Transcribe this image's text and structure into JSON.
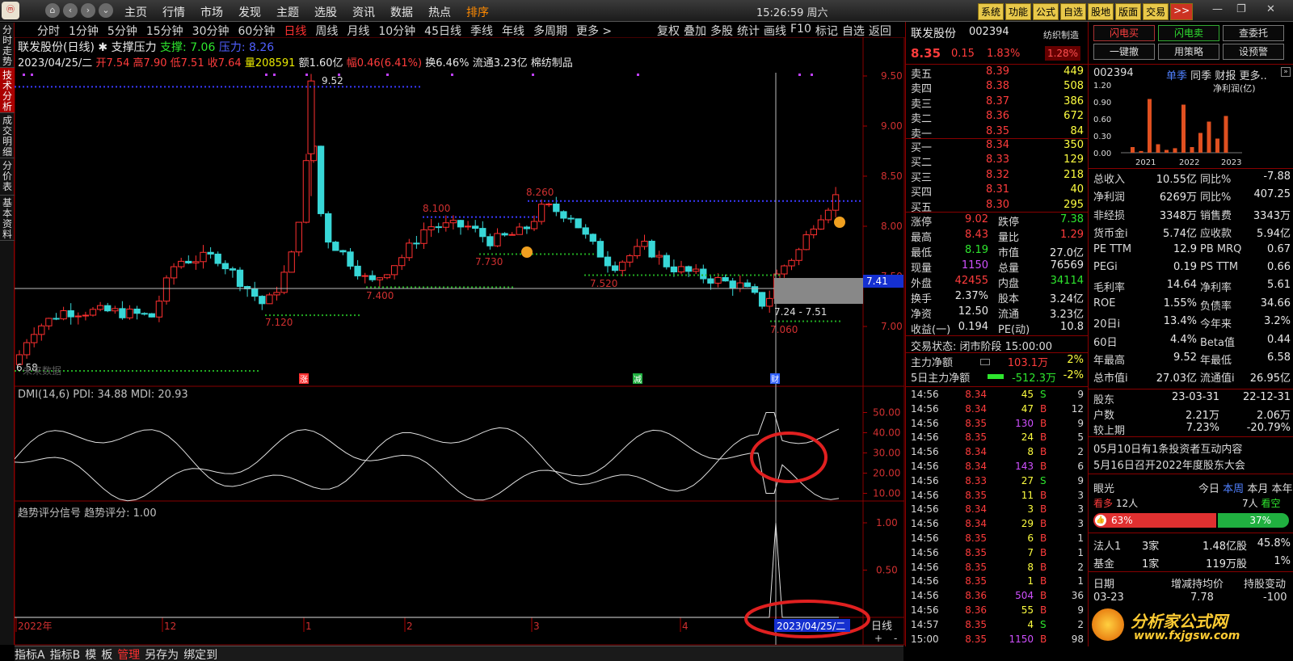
{
  "topbar": {
    "logo": "ⓜ",
    "menu": [
      "主页",
      "行情",
      "市场",
      "发现",
      "主题",
      "选股",
      "资讯",
      "数据",
      "热点",
      "排序"
    ],
    "clock": "15:26:59 周六",
    "buttons": [
      "系统",
      "功能",
      "公式",
      "自选",
      "股地",
      "版面",
      "交易",
      ">>"
    ]
  },
  "vtabs": [
    "分时走势",
    "技术分析",
    "成交明细",
    "分价表",
    "基本资料"
  ],
  "chart_toolbar": {
    "periods": [
      "分时",
      "1分钟",
      "5分钟",
      "15分钟",
      "30分钟",
      "60分钟",
      "日线",
      "周线",
      "月线",
      "10分钟",
      "45日线",
      "季线",
      "年线",
      "多周期",
      "更多 >"
    ],
    "active_period": "日线",
    "right_tools": [
      "复权",
      "叠加",
      "多股",
      "统计",
      "画线",
      "F10",
      "标记",
      "自选",
      "返回"
    ]
  },
  "kline": {
    "title": "联发股份(日线)",
    "indicator": "支撑压力",
    "support_label": "支撑: 7.06",
    "pressure_label": "压力: 8.26",
    "info_date": "2023/04/25/二",
    "info_open": "开7.54",
    "info_high": "高7.90",
    "info_low": "低7.51",
    "info_close": "收7.64",
    "info_vol": "量208591",
    "info_amount": "额1.60亿",
    "info_range": "幅0.46(6.41%)",
    "info_turnover": "换6.46%",
    "info_float": "流通3.23亿",
    "info_industry": "棉纺制品",
    "price_annotations": [
      "9.52",
      "8.100",
      "8.260",
      "7.730",
      "7.520",
      "7.400",
      "7.120",
      "7.24 - 7.51",
      "7.060",
      "6.58"
    ],
    "future_data_label": "未来数据",
    "markers": [
      "涨",
      "减",
      "财"
    ],
    "cursor_price": "7.41"
  },
  "dmi": {
    "label": "DMI(14,6) PDI: 34.88 MDI: 20.93",
    "ticks": [
      "50.00",
      "40.00",
      "30.00",
      "20.00",
      "10.00"
    ]
  },
  "trend": {
    "label": "趋势评分信号  趋势评分: 1.00",
    "ticks": [
      "1.00",
      "0.50"
    ],
    "date_label": "2023/04/25/二",
    "period_label": "日线"
  },
  "x_axis": [
    "2022年",
    "12",
    "1",
    "2",
    "3",
    "4"
  ],
  "statusbar": [
    "指标A",
    "指标B",
    "模",
    "板",
    "管理",
    "另存为",
    "绑定到"
  ],
  "quote": {
    "name": "联发股份",
    "code": "002394",
    "industry": "纺织制造",
    "price": "8.35",
    "change": "0.15",
    "change_pct": "1.83%",
    "industry_pct": "1.28%",
    "asks": [
      {
        "label": "卖五",
        "price": "8.39",
        "vol": "449"
      },
      {
        "label": "卖四",
        "price": "8.38",
        "vol": "508"
      },
      {
        "label": "卖三",
        "price": "8.37",
        "vol": "386"
      },
      {
        "label": "卖二",
        "price": "8.36",
        "vol": "672"
      },
      {
        "label": "卖一",
        "price": "8.35",
        "vol": "84"
      }
    ],
    "bids": [
      {
        "label": "买一",
        "price": "8.34",
        "vol": "350"
      },
      {
        "label": "买二",
        "price": "8.33",
        "vol": "129"
      },
      {
        "label": "买三",
        "price": "8.32",
        "vol": "218"
      },
      {
        "label": "买四",
        "price": "8.31",
        "vol": "40"
      },
      {
        "label": "买五",
        "price": "8.30",
        "vol": "295"
      }
    ],
    "stats": [
      {
        "l1": "涨停",
        "v1": "9.02",
        "c1": "red",
        "l2": "跌停",
        "v2": "7.38",
        "c2": "green"
      },
      {
        "l1": "最高",
        "v1": "8.43",
        "c1": "red",
        "l2": "量比",
        "v2": "1.29",
        "c2": "red"
      },
      {
        "l1": "最低",
        "v1": "8.19",
        "c1": "green",
        "l2": "市值",
        "v2": "27.0亿",
        "c2": "white"
      },
      {
        "l1": "现量",
        "v1": "1150",
        "c1": "purple",
        "l2": "总量",
        "v2": "76569",
        "c2": "white"
      },
      {
        "l1": "外盘",
        "v1": "42455",
        "c1": "red",
        "l2": "内盘",
        "v2": "34114",
        "c2": "green"
      },
      {
        "l1": "换手",
        "v1": "2.37%",
        "c1": "white",
        "l2": "股本",
        "v2": "3.24亿",
        "c2": "white"
      },
      {
        "l1": "净资",
        "v1": "12.50",
        "c1": "white",
        "l2": "流通",
        "v2": "3.23亿",
        "c2": "white"
      },
      {
        "l1": "收益(一)",
        "v1": "0.194",
        "c1": "white",
        "l2": "PE(动)",
        "v2": "10.8",
        "c2": "white"
      }
    ],
    "trade_status": "交易状态: 闭市阶段 15:00:00",
    "main_net": {
      "label": "主力净额",
      "value": "103.1万",
      "pct": "2%"
    },
    "main_net5": {
      "label": "5日主力净额",
      "value": "-512.3万",
      "pct": "-2%"
    },
    "ticks": [
      {
        "t": "14:56",
        "p": "8.34",
        "v": "45",
        "s": "S",
        "n": "9"
      },
      {
        "t": "14:56",
        "p": "8.34",
        "v": "47",
        "s": "B",
        "n": "12"
      },
      {
        "t": "14:56",
        "p": "8.35",
        "v": "130",
        "s": "B",
        "n": "9"
      },
      {
        "t": "14:56",
        "p": "8.35",
        "v": "24",
        "s": "B",
        "n": "5"
      },
      {
        "t": "14:56",
        "p": "8.34",
        "v": "8",
        "s": "B",
        "n": "2"
      },
      {
        "t": "14:56",
        "p": "8.34",
        "v": "143",
        "s": "B",
        "n": "6"
      },
      {
        "t": "14:56",
        "p": "8.33",
        "v": "27",
        "s": "S",
        "n": "9"
      },
      {
        "t": "14:56",
        "p": "8.35",
        "v": "11",
        "s": "B",
        "n": "3"
      },
      {
        "t": "14:56",
        "p": "8.34",
        "v": "3",
        "s": "B",
        "n": "3"
      },
      {
        "t": "14:56",
        "p": "8.34",
        "v": "29",
        "s": "B",
        "n": "3"
      },
      {
        "t": "14:56",
        "p": "8.35",
        "v": "6",
        "s": "B",
        "n": "1"
      },
      {
        "t": "14:56",
        "p": "8.35",
        "v": "7",
        "s": "B",
        "n": "1"
      },
      {
        "t": "14:56",
        "p": "8.35",
        "v": "8",
        "s": "B",
        "n": "2"
      },
      {
        "t": "14:56",
        "p": "8.35",
        "v": "1",
        "s": "B",
        "n": "1"
      },
      {
        "t": "14:56",
        "p": "8.36",
        "v": "504",
        "s": "B",
        "n": "36"
      },
      {
        "t": "14:56",
        "p": "8.36",
        "v": "55",
        "s": "B",
        "n": "9"
      },
      {
        "t": "14:57",
        "p": "8.35",
        "v": "4",
        "s": "S",
        "n": "2"
      },
      {
        "t": "15:00",
        "p": "8.35",
        "v": "1150",
        "s": "B",
        "n": "98"
      }
    ]
  },
  "fin": {
    "buttons": [
      "闪电买",
      "闪电卖",
      "查委托",
      "一键撤",
      "用策略",
      "设预警"
    ],
    "code": "002394",
    "tabs": [
      "单季",
      "同季",
      "财报",
      "更多.."
    ],
    "chart_label": "净利润(亿)",
    "chart_years": [
      "2021",
      "2022",
      "2023"
    ],
    "chart_ticks": [
      "1.20",
      "0.90",
      "0.60",
      "0.30",
      "0.00"
    ],
    "rows": [
      {
        "l1": "总收入",
        "v1": "10.55亿",
        "l2": "同比%",
        "v2": "-7.88"
      },
      {
        "l1": "净利润",
        "v1": "6269万",
        "l2": "同比%",
        "v2": "407.25"
      },
      {
        "l1": "非经损",
        "v1": "3348万",
        "l2": "销售费",
        "v2": "3343万"
      },
      {
        "l1": "货币金i",
        "v1": "5.74亿",
        "l2": "应收款",
        "v2": "5.94亿"
      },
      {
        "l1": "PE TTM",
        "v1": "12.9",
        "l2": "PB MRQ",
        "v2": "0.67"
      },
      {
        "l1": "PEGi",
        "v1": "0.19",
        "l2": "PS TTM",
        "v2": "0.66"
      },
      {
        "l1": "毛利率",
        "v1": "14.64",
        "l2": "净利率",
        "v2": "5.61"
      },
      {
        "l1": "ROE",
        "v1": "1.55%",
        "l2": "负债率",
        "v2": "34.66"
      },
      {
        "l1": "20日i",
        "v1": "13.4%",
        "l2": "今年来",
        "v2": "3.2%"
      },
      {
        "l1": "60日",
        "v1": "4.4%",
        "l2": "Beta值",
        "v2": "0.44"
      },
      {
        "l1": "年最高",
        "v1": "9.52",
        "l2": "年最低",
        "v2": "6.58"
      },
      {
        "l1": "总市值i",
        "v1": "27.03亿",
        "l2": "流通值i",
        "v2": "26.95亿"
      }
    ],
    "holders": [
      {
        "l1": "股东",
        "v1": "23-03-31",
        "v2": "22-12-31"
      },
      {
        "l1": "户数",
        "v1": "2.21万",
        "v2": "2.06万"
      },
      {
        "l1": "较上期",
        "v1": "7.23%",
        "v2": "-20.79%"
      }
    ],
    "notices": [
      "05月10日有1条投资者互动内容",
      "5月16日召开2022年度股东大会"
    ],
    "eyes": {
      "label": "眼光",
      "tabs": [
        "今日",
        "本周",
        "本月",
        "本年"
      ],
      "bull": "看多",
      "bull_n": "12人",
      "bear_n": "7人",
      "bear": "看空",
      "bull_pct": "63%",
      "bear_pct": "37%"
    },
    "inst": [
      {
        "l": "法人1",
        "a": "3家",
        "b": "1.48亿股",
        "c": "45.8%"
      },
      {
        "l": "基金",
        "a": "1家",
        "b": "119万股",
        "c": "1%"
      }
    ],
    "table_head": [
      "日期",
      "增减持均价",
      "持股变动"
    ],
    "table_row": [
      "03-23",
      "7.78",
      "-100"
    ],
    "watermark": "分析家公式网",
    "watermark_url": "www.fxjgsw.com"
  }
}
